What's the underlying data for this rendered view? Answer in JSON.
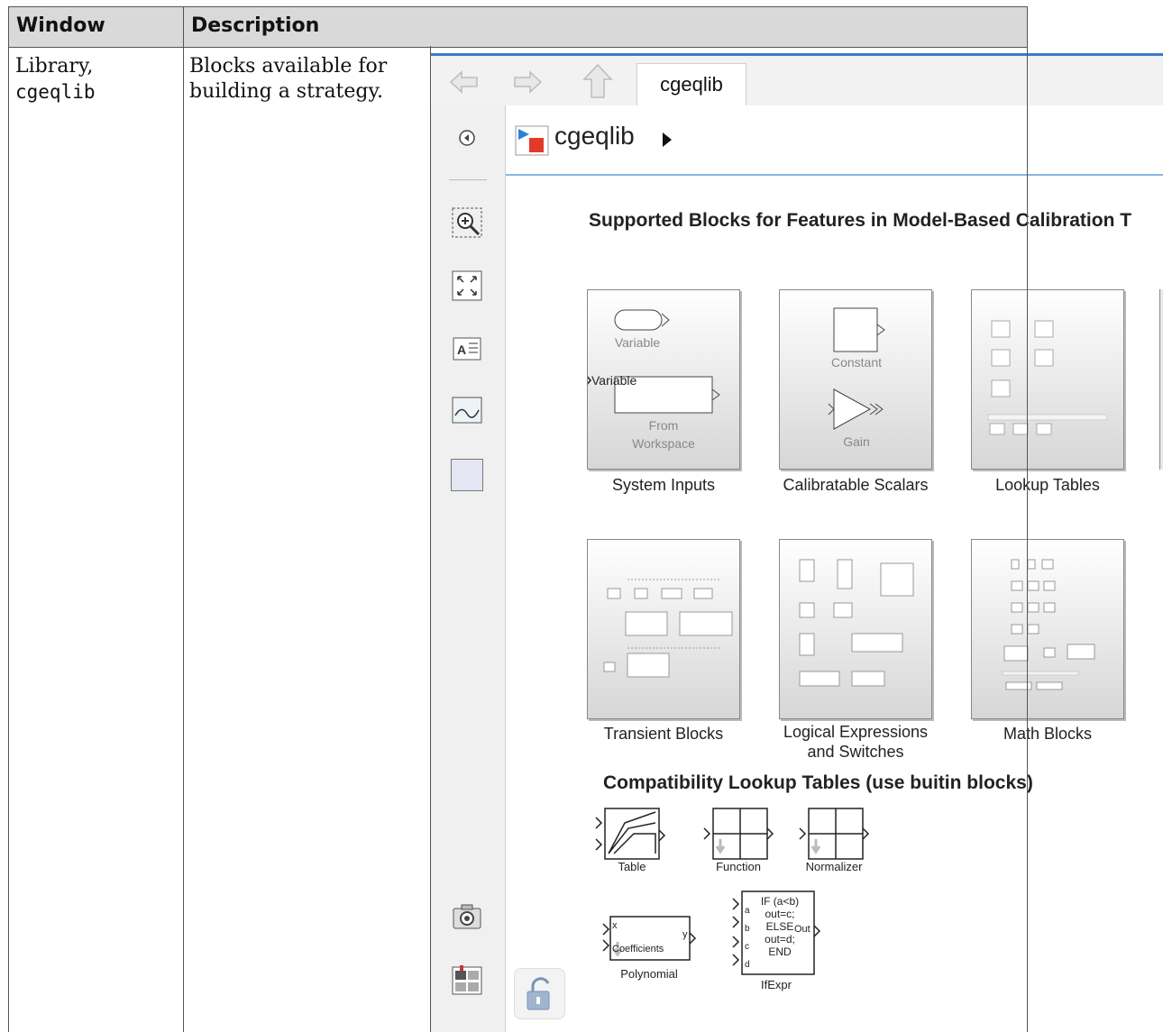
{
  "table": {
    "headers": {
      "window": "Window",
      "description": "Description"
    },
    "row": {
      "window_line1": "Library,",
      "window_line2": "cgeqlib",
      "description_line1": "Blocks available for",
      "description_line2": "building a strategy."
    }
  },
  "simulink": {
    "tab_label": "cgeqlib",
    "address_title": "cgeqlib",
    "canvas_title": "Supported Blocks for Features in Model-Based Calibration T",
    "blocks": {
      "system_inputs": "System Inputs",
      "calibratable_scalars": "Calibratable Scalars",
      "lookup_tables": "Lookup Tables",
      "transient_blocks": "Transient Blocks",
      "logical_expressions_l1": "Logical Expressions",
      "logical_expressions_l2": "and Switches",
      "math_blocks": "Math Blocks"
    },
    "mini": {
      "variable": "Variable",
      "variable_port": "Variable",
      "from_workspace_l1": "From",
      "from_workspace_l2": "Workspace",
      "constant": "Constant",
      "gain": "Gain"
    },
    "compat_title": "Compatibility Lookup Tables (use buitin blocks)",
    "compat": {
      "table": "Table",
      "function": "Function",
      "normalizer": "Normalizer",
      "polynomial": "Polynomial",
      "coefficients": "Coefficients",
      "ifexpr": "IfExpr",
      "if_code": [
        "IF (a<b)",
        "out=c;",
        "ELSE",
        "out=d;",
        "END"
      ],
      "port_out": "Out",
      "port_x": "x",
      "port_y": "y",
      "ports_abcd": [
        "a",
        "b",
        "c",
        "d"
      ]
    },
    "left_toolbar": [
      "hide-explorer-icon",
      "zoom-icon",
      "fit-view-icon",
      "annotation-icon",
      "image-icon",
      "area-icon",
      "screenshot-icon",
      "property-inspector-icon",
      "collapse-icon"
    ]
  }
}
